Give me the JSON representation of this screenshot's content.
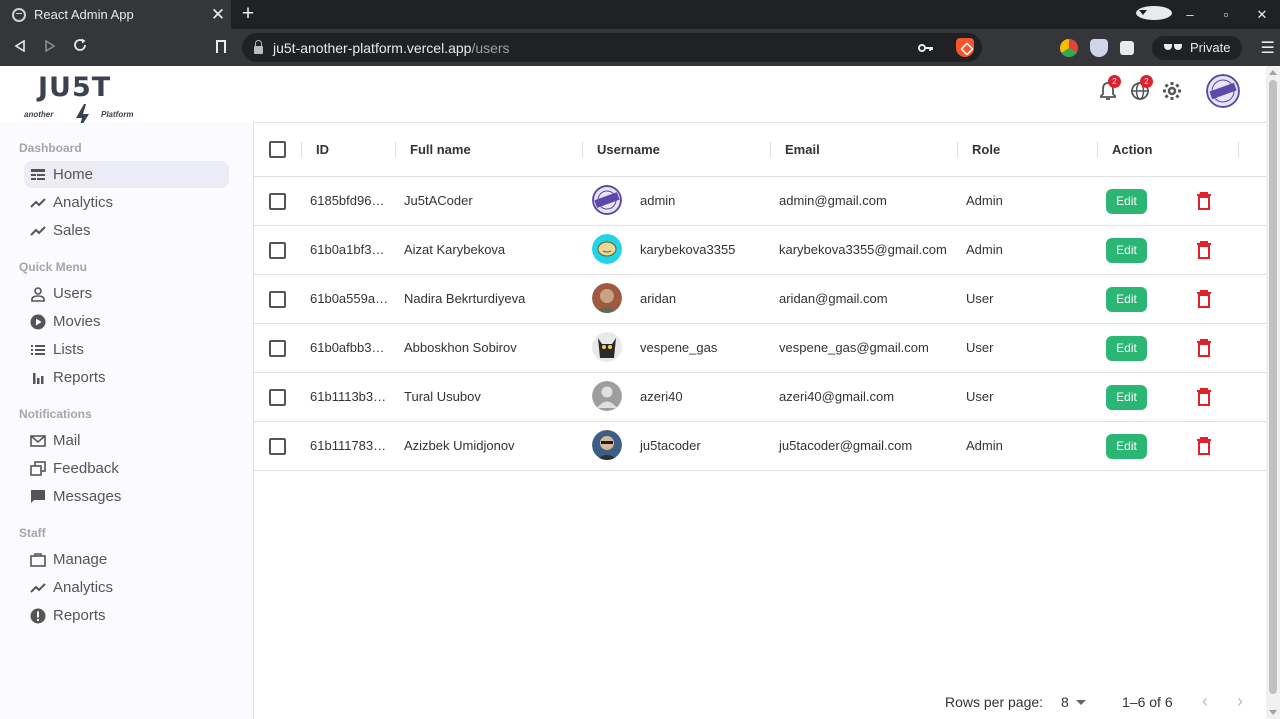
{
  "browser": {
    "tab_title": "React Admin App",
    "tab_close": "✕",
    "new_tab": "+",
    "url_host": "ju5t-another-platform.vercel.app",
    "url_path": "/users",
    "private_label": "Private",
    "minimize": "–",
    "maximize": "▫",
    "close": "✕"
  },
  "logo": {
    "main": "JU5T",
    "sub_left": "another",
    "sub_right": "Platform"
  },
  "topbar": {
    "notifications_badge": "2",
    "language_badge": "2"
  },
  "sidebar": {
    "sections": [
      {
        "title": "Dashboard",
        "items": [
          {
            "label": "Home",
            "icon": "home-icon",
            "active": true
          },
          {
            "label": "Analytics",
            "icon": "trending-up-icon"
          },
          {
            "label": "Sales",
            "icon": "trending-up-icon"
          }
        ]
      },
      {
        "title": "Quick Menu",
        "items": [
          {
            "label": "Users",
            "icon": "person-icon"
          },
          {
            "label": "Movies",
            "icon": "play-circle-icon"
          },
          {
            "label": "Lists",
            "icon": "list-icon"
          },
          {
            "label": "Reports",
            "icon": "bar-chart-icon"
          }
        ]
      },
      {
        "title": "Notifications",
        "items": [
          {
            "label": "Mail",
            "icon": "mail-icon"
          },
          {
            "label": "Feedback",
            "icon": "feedback-icon"
          },
          {
            "label": "Messages",
            "icon": "message-icon"
          }
        ]
      },
      {
        "title": "Staff",
        "items": [
          {
            "label": "Manage",
            "icon": "briefcase-icon"
          },
          {
            "label": "Analytics",
            "icon": "trending-up-icon"
          },
          {
            "label": "Reports",
            "icon": "report-icon"
          }
        ]
      }
    ]
  },
  "table": {
    "columns": [
      "ID",
      "Full name",
      "Username",
      "Email",
      "Role",
      "Action"
    ],
    "edit_label": "Edit",
    "rows": [
      {
        "id": "6185bfd96…",
        "full_name": "Ju5tACoder",
        "username": "admin",
        "email": "admin@gmail.com",
        "role": "Admin",
        "avatar": "admin-stamp"
      },
      {
        "id": "61b0a1bf3…",
        "full_name": "Aizat Karybekova",
        "username": "karybekova3355",
        "email": "karybekova3355@gmail.com",
        "role": "Admin",
        "avatar": "cyan-face"
      },
      {
        "id": "61b0a559a…",
        "full_name": "Nadira Bekrturdiyeva",
        "username": "aridan",
        "email": "aridan@gmail.com",
        "role": "User",
        "avatar": "photo-brown"
      },
      {
        "id": "61b0afbb3…",
        "full_name": "Abboskhon Sobirov",
        "username": "vespene_gas",
        "email": "vespene_gas@gmail.com",
        "role": "User",
        "avatar": "photo-dark"
      },
      {
        "id": "61b1113b3…",
        "full_name": "Tural Usubov",
        "username": "azeri40",
        "email": "azeri40@gmail.com",
        "role": "User",
        "avatar": "default-person"
      },
      {
        "id": "61b111783…",
        "full_name": "Azizbek Umidjonov",
        "username": "ju5tacoder",
        "email": "ju5tacoder@gmail.com",
        "role": "Admin",
        "avatar": "photo-blue"
      }
    ]
  },
  "pagination": {
    "rows_per_page_label": "Rows per page:",
    "rows_per_page_value": "8",
    "range": "1–6 of 6",
    "prev": "‹",
    "next": "›"
  },
  "colors": {
    "edit_button": "#2bb673",
    "delete_icon": "#e0202c",
    "badge": "#e0202c",
    "sidebar_bg": "#fbfbff",
    "active_item": "#ececf7"
  }
}
